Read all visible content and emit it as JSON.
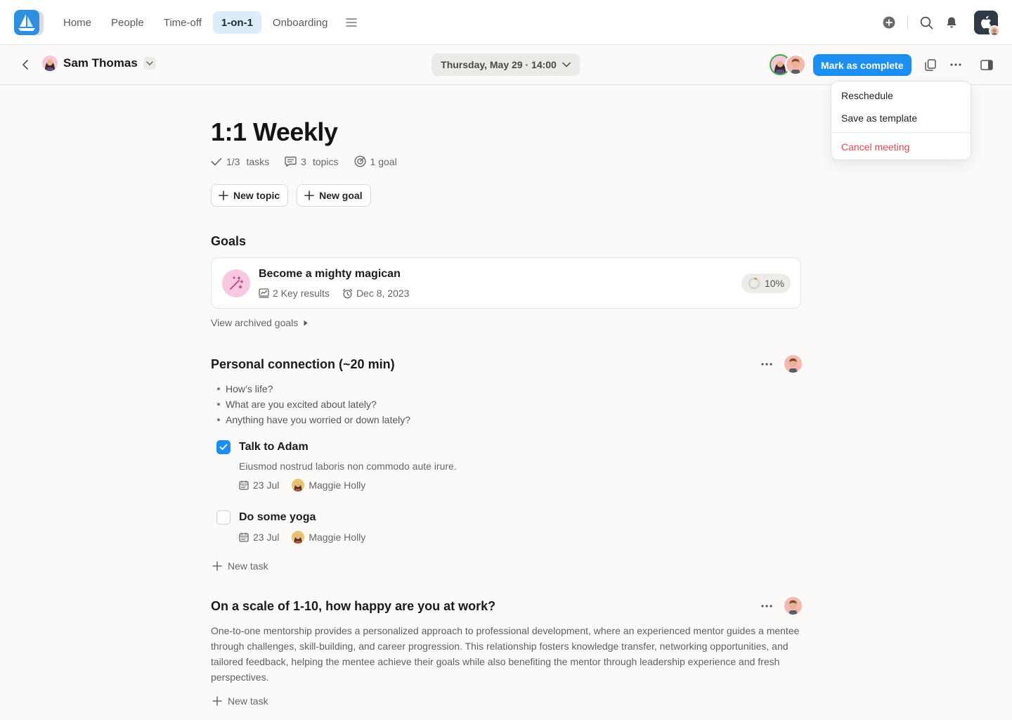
{
  "nav": {
    "links": [
      "Home",
      "People",
      "Time-off",
      "1-on-1",
      "Onboarding"
    ],
    "active": "1-on-1"
  },
  "subbar": {
    "person_name": "Sam Thomas",
    "date": "Thursday, May 29 · 14:00",
    "complete_label": "Mark as complete"
  },
  "dropdown": {
    "reschedule": "Reschedule",
    "save_template": "Save as template",
    "cancel": "Cancel meeting"
  },
  "meeting": {
    "title": "1:1 Weekly",
    "tasks_count": "1/3",
    "tasks_label": "tasks",
    "topics_count": "3",
    "topics_label": "topics",
    "goal_label": "1 goal",
    "new_topic": "New topic",
    "new_goal": "New goal"
  },
  "goals": {
    "heading": "Goals",
    "goal_title": "Become a mighty magican",
    "key_results": "2 Key results",
    "due": "Dec 8, 2023",
    "progress_text": "10%",
    "progress_value": 0.1,
    "archived": "View archived goals"
  },
  "topic1": {
    "title": "Personal connection (~20 min)",
    "bullets": [
      "How’s life?",
      "What are you excited about lately?",
      "Anything have you worried or down lately?"
    ],
    "tasks": [
      {
        "title": "Talk to Adam",
        "desc": "Eiusmod nostrud laboris non commodo aute irure.",
        "date": "23 Jul",
        "assignee": "Maggie Holly",
        "done": true
      },
      {
        "title": "Do some yoga",
        "date": "23 Jul",
        "assignee": "Maggie Holly",
        "done": false
      }
    ],
    "new_task": "New task"
  },
  "topic2": {
    "title": "On a scale of 1-10, how happy are you at work?",
    "body": "One-to-one mentorship provides a personalized approach to professional development, where an experienced mentor guides a mentee through challenges, skill-building, and career progression. This relationship fosters knowledge transfer, networking opportunities, and tailored feedback, helping the mentee achieve their goals while also benefiting the mentor through leadership experience and fresh perspectives.",
    "new_task": "New task"
  },
  "colors": {
    "accent": "#1d8ff2",
    "danger": "#e5484d",
    "nav_active_bg": "#dcecfb"
  }
}
